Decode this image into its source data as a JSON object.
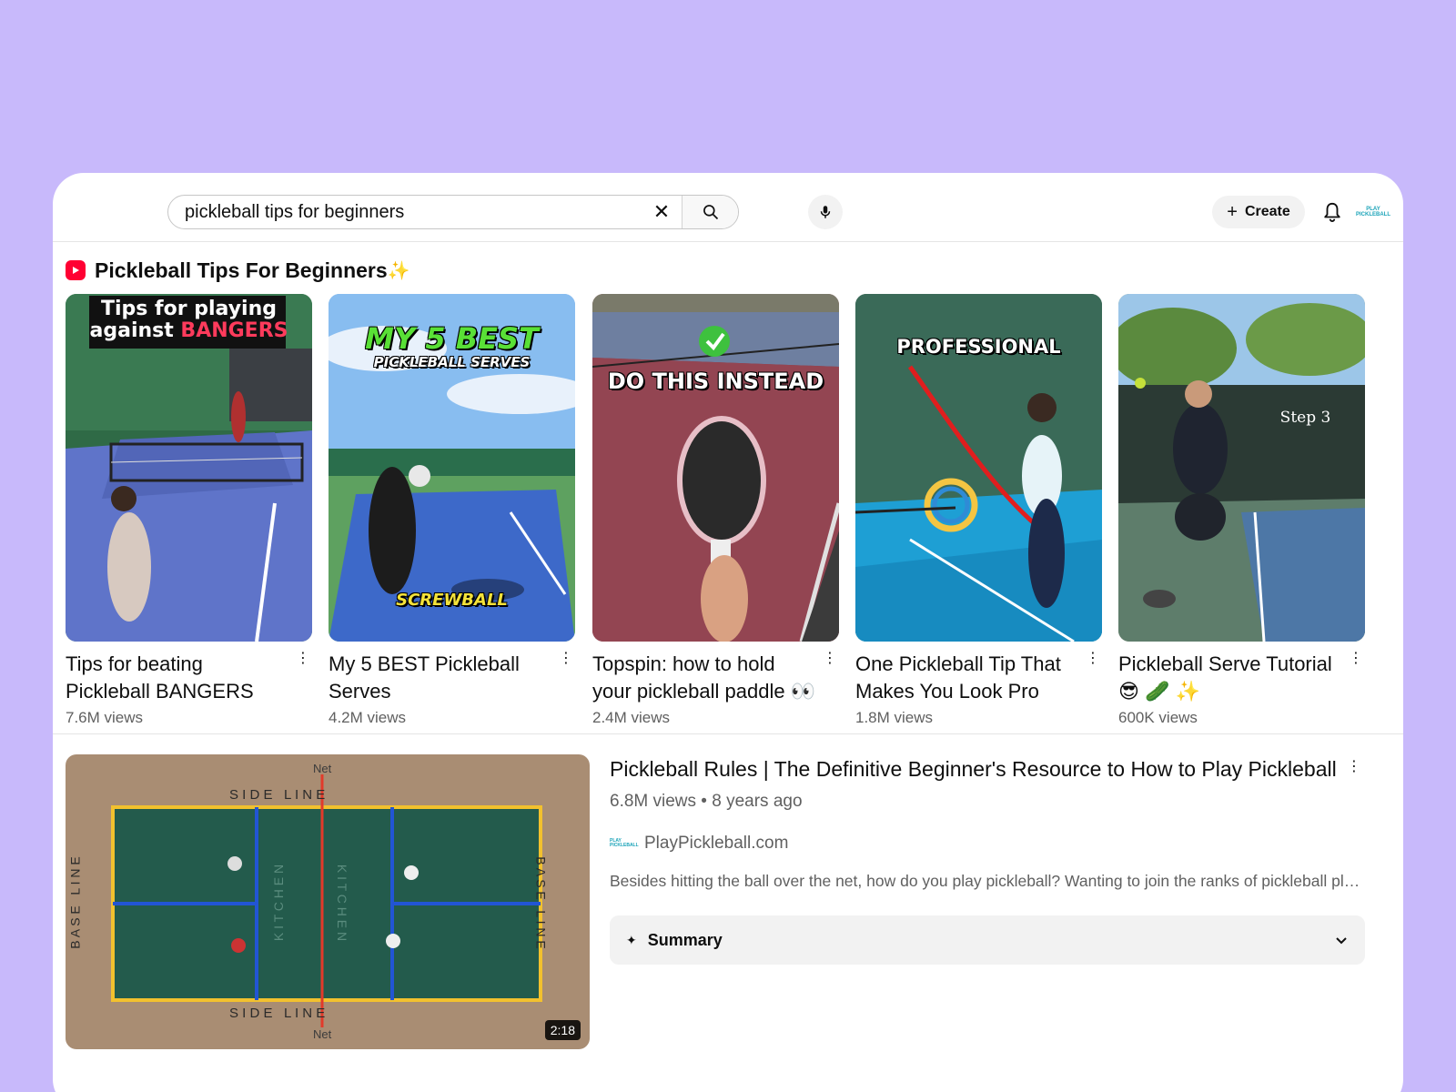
{
  "search": {
    "query": "pickleball tips for beginners",
    "clear_glyph": "✕"
  },
  "header": {
    "create_label": "Create",
    "create_glyph": "+",
    "avatar_text_1": "PLAY",
    "avatar_text_2": "PICKLEBALL"
  },
  "shelf": {
    "title": "Pickleball Tips For Beginners",
    "title_emoji": "✨",
    "items": [
      {
        "title": "Tips for beating Pickleball BANGERS",
        "views": "7.6M views",
        "overlay_1": "Tips for playing",
        "overlay_2a": "against ",
        "overlay_2b": "BANGERS"
      },
      {
        "title": "My 5 BEST Pickleball Serves",
        "views": "4.2M views",
        "overlay_1": "MY 5 BEST",
        "overlay_2": "PICKLEBALL SERVES",
        "overlay_3": "SCREWBALL"
      },
      {
        "title": "Topspin: how to hold your pickleball paddle 👀",
        "views": "2.4M views",
        "overlay_1": "DO THIS INSTEAD"
      },
      {
        "title": "One Pickleball Tip That Makes You Look Pro",
        "views": "1.8M views",
        "overlay_1": "PROFESSIONAL"
      },
      {
        "title": "Pickleball Serve Tutorial 😎 🥒 ✨",
        "views": "600K views",
        "overlay_1": "Step 3"
      }
    ],
    "menu_glyph": "⋮"
  },
  "video": {
    "title": "Pickleball Rules | The Definitive Beginner's Resource to How to Play Pickleball",
    "meta": "6.8M views • 8 years ago",
    "channel": "PlayPickleball.com",
    "description": "Besides hitting the ball over the net, how do you play pickleball? Wanting to join the ranks of pickleball players?",
    "duration": "2:18",
    "summary_label": "Summary",
    "summary_glyph": "✦",
    "court_labels": {
      "net": "Net",
      "sideline": "S I D E   L I N E",
      "baseline": "B A S E   L I N E",
      "kitchen": "K I T C H E N"
    }
  },
  "colors": {
    "background": "#c8b9fb",
    "brand_red": "#ff0033",
    "text_secondary": "#606060"
  }
}
